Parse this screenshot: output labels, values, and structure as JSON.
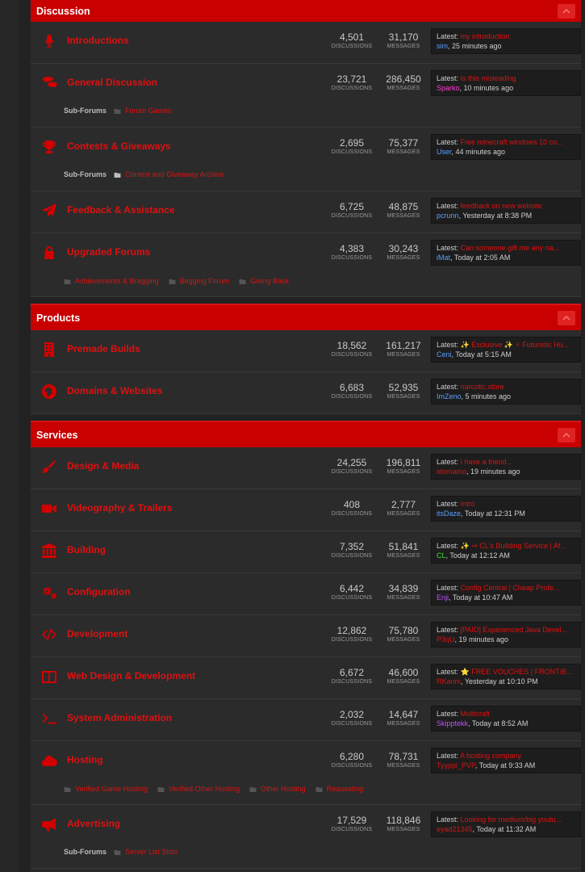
{
  "colors": {
    "accent": "#c80000",
    "link": "#e01010",
    "background": "#2b2b2b"
  },
  "stats_labels": {
    "discussions": "DISCUSSIONS",
    "messages": "MESSAGES"
  },
  "latest_label": "Latest:",
  "subforums_label": "Sub-Forums",
  "sections": [
    {
      "title": "Discussion",
      "nodes": [
        {
          "title": "Introductions",
          "icon": "microphone-icon",
          "discussions": "4,501",
          "messages": "31,170",
          "latest_thread": "my introduction",
          "latest_user": "sim",
          "user_color": "#5aa0ff",
          "latest_time": ", 25 minutes ago"
        },
        {
          "title": "General Discussion",
          "icon": "chat-bubbles-icon",
          "discussions": "23,721",
          "messages": "286,450",
          "latest_thread": "Is this misleading",
          "latest_user": "Sparko",
          "user_color": "#ff3bd0",
          "latest_time": ", 10 minutes ago",
          "subforums_prefix": true,
          "subforums": [
            {
              "label": "Forum Games",
              "solid": false
            }
          ]
        },
        {
          "title": "Contests & Giveaways",
          "icon": "trophy-icon",
          "discussions": "2,695",
          "messages": "75,377",
          "latest_thread": "Free minecraft windows 10 co...",
          "latest_user": "User",
          "user_color": "#5aa0ff",
          "latest_time": ", 44 minutes ago",
          "subforums_prefix": true,
          "subforums": [
            {
              "label": "Contest and Giveaway Archive",
              "solid": true
            }
          ]
        },
        {
          "title": "Feedback & Assistance",
          "icon": "paper-plane-icon",
          "discussions": "6,725",
          "messages": "48,875",
          "latest_thread": "feedback on new website",
          "latest_user": "pcrunn",
          "user_color": "#5aa0ff",
          "latest_time": ", Yesterday at 8:38 PM"
        },
        {
          "title": "Upgraded Forums",
          "icon": "lock-icon",
          "discussions": "4,383",
          "messages": "30,243",
          "latest_thread": "Can someone gift me any na...",
          "latest_user": "iMat",
          "user_color": "#5aa0ff",
          "latest_time": ", Today at 2:05 AM",
          "subforums_prefix": false,
          "subforums": [
            {
              "label": "Achievements & Bragging",
              "solid": false
            },
            {
              "label": "Begging Forum",
              "solid": false
            },
            {
              "label": "Giving Back",
              "solid": false
            }
          ]
        }
      ]
    },
    {
      "title": "Products",
      "nodes": [
        {
          "title": "Premade Builds",
          "icon": "building-icon",
          "discussions": "18,562",
          "messages": "161,217",
          "latest_thread": "✨ Exclusive ✨ ⚡ Futuristic Hu...",
          "latest_user": "Ceni",
          "user_color": "#5aa0ff",
          "latest_time": ", Today at 5:15 AM"
        },
        {
          "title": "Domains & Websites",
          "icon": "globe-icon",
          "discussions": "6,683",
          "messages": "52,935",
          "latest_thread": "narcotic.store",
          "latest_user": "ImZeno",
          "user_color": "#5aa0ff",
          "latest_time": ", 5 minutes ago"
        }
      ]
    },
    {
      "title": "Services",
      "nodes": [
        {
          "title": "Design & Media",
          "icon": "paintbrush-icon",
          "discussions": "24,255",
          "messages": "196,811",
          "latest_thread": "I have a friend...",
          "latest_user": "idomamo",
          "user_color": "#e01010",
          "latest_time": ", 19 minutes ago"
        },
        {
          "title": "Videography & Trailers",
          "icon": "video-camera-icon",
          "discussions": "408",
          "messages": "2,777",
          "latest_thread": "Intro",
          "latest_user": "itsDaze",
          "user_color": "#5aa0ff",
          "latest_time": ", Today at 12:31 PM"
        },
        {
          "title": "Building",
          "icon": "bank-icon",
          "discussions": "7,352",
          "messages": "51,841",
          "latest_thread": "✨ ⇒ CL's Building Service | Af...",
          "latest_user": "CL",
          "user_color": "#3ee03e",
          "latest_time": ", Today at 12:12 AM"
        },
        {
          "title": "Configuration",
          "icon": "cogs-icon",
          "discussions": "6,442",
          "messages": "34,839",
          "latest_thread": "Config Central | Cheap Profe...",
          "latest_user": "Enji",
          "user_color": "#c050ff",
          "latest_time": ", Today at 10:47 AM"
        },
        {
          "title": "Development",
          "icon": "code-icon",
          "discussions": "12,862",
          "messages": "75,780",
          "latest_thread": "[PAID] Experienced Java Devel...",
          "latest_user": "P3qU",
          "user_color": "#e01010",
          "latest_time": ", 19 minutes ago"
        },
        {
          "title": "Web Design & Development",
          "icon": "book-open-icon",
          "discussions": "6,672",
          "messages": "46,600",
          "latest_thread": "⭐ FREE VOUCHES | FRONT/B...",
          "latest_user": "RKarim",
          "user_color": "#e01010",
          "latest_time": ", Yesterday at 10:10 PM"
        },
        {
          "title": "System Administration",
          "icon": "terminal-icon",
          "discussions": "2,032",
          "messages": "14,647",
          "latest_thread": "Multicraft",
          "latest_user": "Skipptekk",
          "user_color": "#c050ff",
          "latest_time": ", Today at 8:52 AM"
        },
        {
          "title": "Hosting",
          "icon": "cloud-icon",
          "discussions": "6,280",
          "messages": "78,731",
          "latest_thread": "A hosting company",
          "latest_user": "Tyyppi_PVP",
          "user_color": "#e01010",
          "latest_time": ", Today at 9:33 AM",
          "subforums_prefix": false,
          "subforums": [
            {
              "label": "Verified Game Hosting",
              "solid": false
            },
            {
              "label": "Verified Other Hosting",
              "solid": false
            },
            {
              "label": "Other Hosting",
              "solid": false
            },
            {
              "label": "Requesting",
              "solid": false
            }
          ]
        },
        {
          "title": "Advertising",
          "icon": "megaphone-icon",
          "discussions": "17,529",
          "messages": "118,846",
          "latest_thread": "Looking for medium/big youtu...",
          "latest_user": "eyad21345",
          "user_color": "#e01010",
          "latest_time": ", Today at 11:32 AM",
          "subforums_prefix": true,
          "subforums": [
            {
              "label": "Server List Slots",
              "solid": false
            }
          ]
        }
      ]
    }
  ]
}
